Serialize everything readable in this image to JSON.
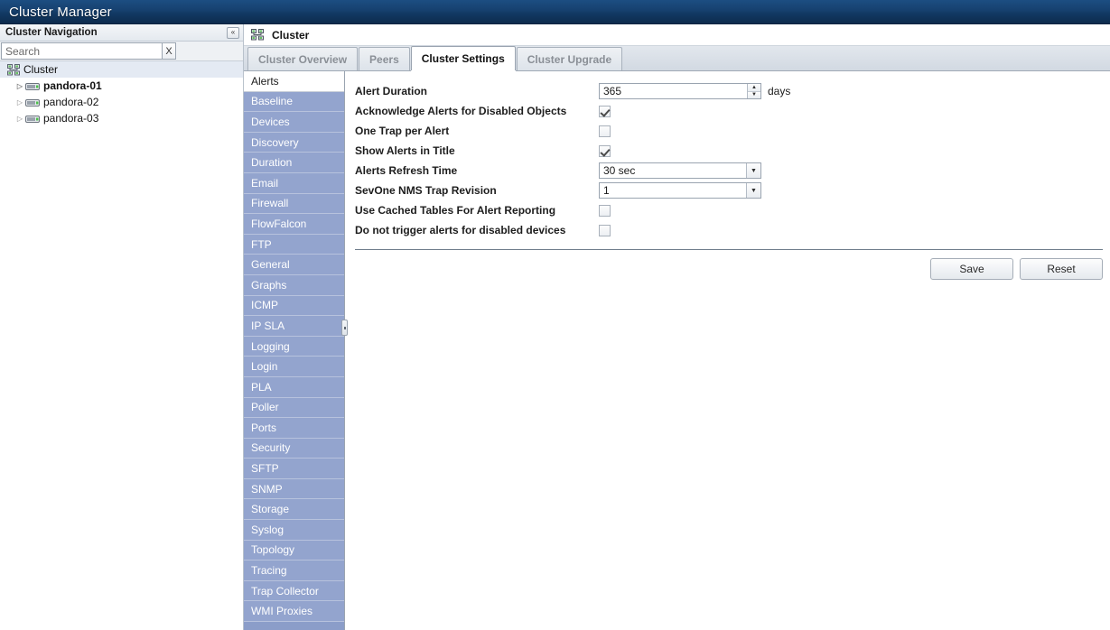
{
  "window": {
    "title": "Cluster Manager"
  },
  "sidebar": {
    "header_title": "Cluster Navigation",
    "collapse_icon": "collapse-left-icon",
    "collapse_glyph": "«",
    "search": {
      "placeholder": "Search",
      "value": "",
      "clear_label": "X"
    },
    "tree": [
      {
        "label": "Cluster",
        "icon": "cluster-icon",
        "level": 0,
        "bold": false,
        "expandable": false,
        "selected": true
      },
      {
        "label": "pandora-01",
        "icon": "server-icon",
        "level": 1,
        "bold": true,
        "expandable": true,
        "selected": false
      },
      {
        "label": "pandora-02",
        "icon": "server-icon",
        "level": 1,
        "bold": false,
        "expandable": true,
        "selected": false
      },
      {
        "label": "pandora-03",
        "icon": "server-icon",
        "level": 1,
        "bold": false,
        "expandable": true,
        "selected": false
      }
    ]
  },
  "content": {
    "header_title": "Cluster",
    "header_icon": "cluster-icon",
    "tabs": [
      {
        "label": "Cluster Overview",
        "active": false
      },
      {
        "label": "Peers",
        "active": false
      },
      {
        "label": "Cluster Settings",
        "active": true
      },
      {
        "label": "Cluster Upgrade",
        "active": false
      }
    ],
    "categories": [
      {
        "label": "Alerts",
        "selected": true
      },
      {
        "label": "Baseline",
        "selected": false
      },
      {
        "label": "Devices",
        "selected": false
      },
      {
        "label": "Discovery",
        "selected": false
      },
      {
        "label": "Duration",
        "selected": false
      },
      {
        "label": "Email",
        "selected": false
      },
      {
        "label": "Firewall",
        "selected": false
      },
      {
        "label": "FlowFalcon",
        "selected": false
      },
      {
        "label": "FTP",
        "selected": false
      },
      {
        "label": "General",
        "selected": false
      },
      {
        "label": "Graphs",
        "selected": false
      },
      {
        "label": "ICMP",
        "selected": false
      },
      {
        "label": "IP SLA",
        "selected": false
      },
      {
        "label": "Logging",
        "selected": false
      },
      {
        "label": "Login",
        "selected": false
      },
      {
        "label": "PLA",
        "selected": false
      },
      {
        "label": "Poller",
        "selected": false
      },
      {
        "label": "Ports",
        "selected": false
      },
      {
        "label": "Security",
        "selected": false
      },
      {
        "label": "SFTP",
        "selected": false
      },
      {
        "label": "SNMP",
        "selected": false
      },
      {
        "label": "Storage",
        "selected": false
      },
      {
        "label": "Syslog",
        "selected": false
      },
      {
        "label": "Topology",
        "selected": false
      },
      {
        "label": "Tracing",
        "selected": false
      },
      {
        "label": "Trap Collector",
        "selected": false
      },
      {
        "label": "WMI Proxies",
        "selected": false
      }
    ],
    "form": {
      "alert_duration": {
        "label": "Alert Duration",
        "value": "365",
        "unit": "days"
      },
      "acknowledge_alerts": {
        "label": "Acknowledge Alerts for Disabled Objects",
        "checked": true
      },
      "one_trap_per_alert": {
        "label": "One Trap per Alert",
        "checked": false
      },
      "show_alerts_in_title": {
        "label": "Show Alerts in Title",
        "checked": true
      },
      "alerts_refresh_time": {
        "label": "Alerts Refresh Time",
        "value": "30 sec"
      },
      "trap_revision": {
        "label": "SevOne NMS Trap Revision",
        "value": "1"
      },
      "use_cached_tables": {
        "label": "Use Cached Tables For Alert Reporting",
        "checked": false
      },
      "no_trigger_disabled": {
        "label": "Do not trigger alerts for disabled devices",
        "checked": false
      }
    },
    "buttons": {
      "save": "Save",
      "reset": "Reset"
    }
  },
  "colors": {
    "titlebar": "#16406e",
    "category_blue": "#93a4ce",
    "tab_strip": "#d2d9e2",
    "tree_selected": "#e4eaf3"
  }
}
